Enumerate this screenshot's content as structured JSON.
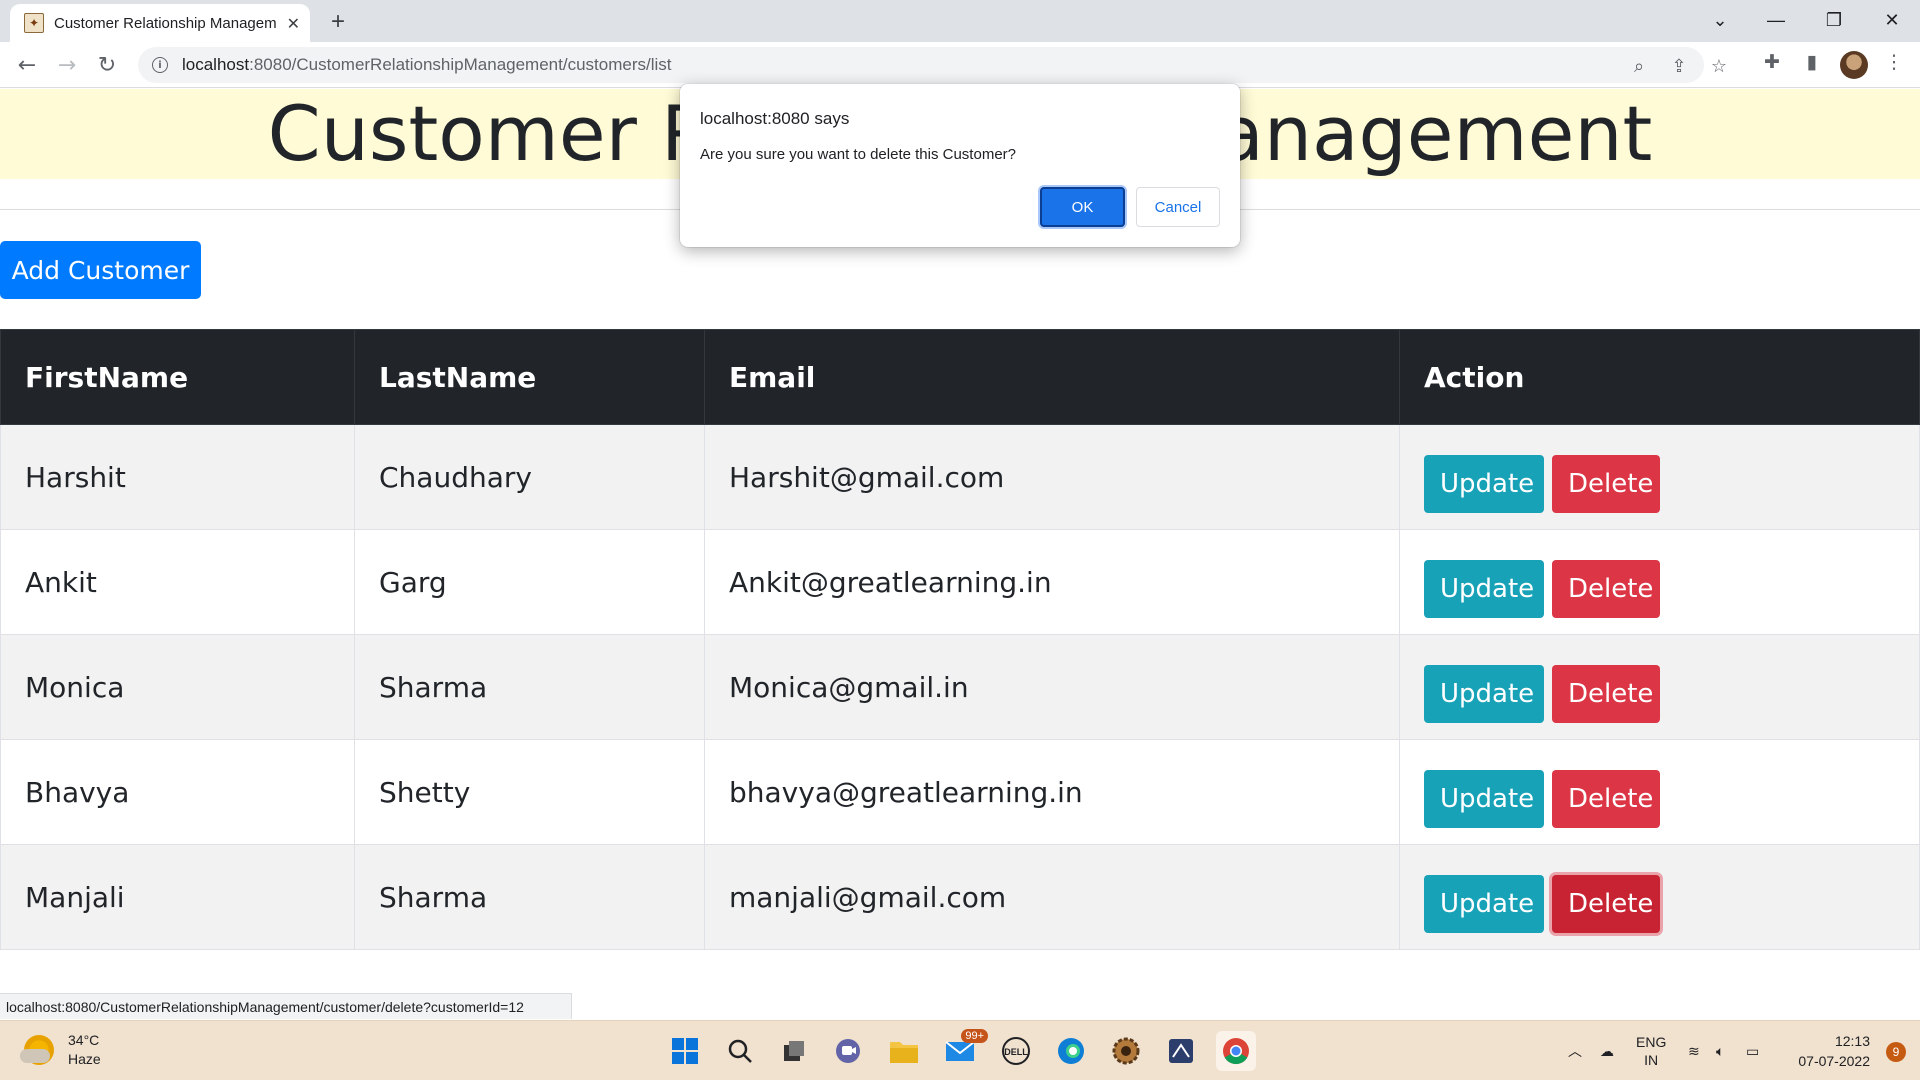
{
  "browser": {
    "tab_title": "Customer Relationship Management",
    "tab_close": "✕",
    "new_tab": "+",
    "url_host": "localhost",
    "url_rest": ":8080/CustomerRelationshipManagement/customers/list",
    "status_url": "localhost:8080/CustomerRelationshipManagement/customer/delete?customerId=12"
  },
  "page": {
    "heading": "Customer Relationship Management",
    "add_button": "Add Customer",
    "columns": [
      "FirstName",
      "LastName",
      "Email",
      "Action"
    ],
    "rows": [
      {
        "first": "Harshit",
        "last": "Chaudhary",
        "email": "Harshit@gmail.com"
      },
      {
        "first": "Ankit",
        "last": "Garg",
        "email": "Ankit@greatlearning.in"
      },
      {
        "first": "Monica",
        "last": "Sharma",
        "email": "Monica@gmail.in"
      },
      {
        "first": "Bhavya",
        "last": "Shetty",
        "email": "bhavya@greatlearning.in"
      },
      {
        "first": "Manjali",
        "last": "Sharma",
        "email": "manjali@gmail.com"
      }
    ],
    "update_label": "Update",
    "delete_label": "Delete"
  },
  "dialog": {
    "origin": "localhost:8080 says",
    "message": "Are you sure you want to delete this Customer?",
    "ok": "OK",
    "cancel": "Cancel"
  },
  "taskbar": {
    "temp": "34°C",
    "condition": "Haze",
    "mail_badge": "99+",
    "lang": "ENG",
    "region": "IN",
    "time": "12:13",
    "date": "07-07-2022",
    "notifications": "9"
  },
  "colors": {
    "primary": "#007bff",
    "info": "#17a2b8",
    "danger": "#dc3545",
    "dark": "#212529",
    "banner": "#fffbd6"
  }
}
